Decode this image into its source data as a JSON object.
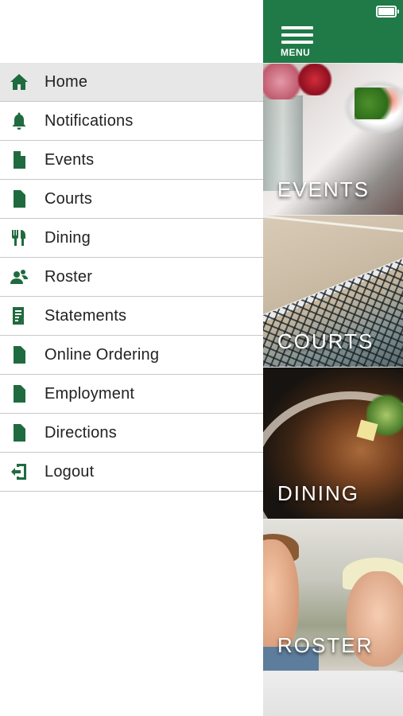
{
  "drawer": {
    "items": [
      {
        "label": "Home",
        "icon": "home-icon",
        "active": true
      },
      {
        "label": "Notifications",
        "icon": "bell-icon",
        "active": false
      },
      {
        "label": "Events",
        "icon": "document-icon",
        "active": false
      },
      {
        "label": "Courts",
        "icon": "document-icon",
        "active": false
      },
      {
        "label": "Dining",
        "icon": "utensils-icon",
        "active": false
      },
      {
        "label": "Roster",
        "icon": "people-icon",
        "active": false
      },
      {
        "label": "Statements",
        "icon": "statement-icon",
        "active": false
      },
      {
        "label": "Online Ordering",
        "icon": "document-icon",
        "active": false
      },
      {
        "label": "Employment",
        "icon": "document-icon",
        "active": false
      },
      {
        "label": "Directions",
        "icon": "document-icon",
        "active": false
      },
      {
        "label": "Logout",
        "icon": "logout-icon",
        "active": false
      }
    ]
  },
  "header": {
    "menu_label": "MENU",
    "brand_color": "#1f7a48"
  },
  "tiles": [
    {
      "label": "EVENTS"
    },
    {
      "label": "COURTS"
    },
    {
      "label": "DINING"
    },
    {
      "label": "ROSTER"
    }
  ]
}
